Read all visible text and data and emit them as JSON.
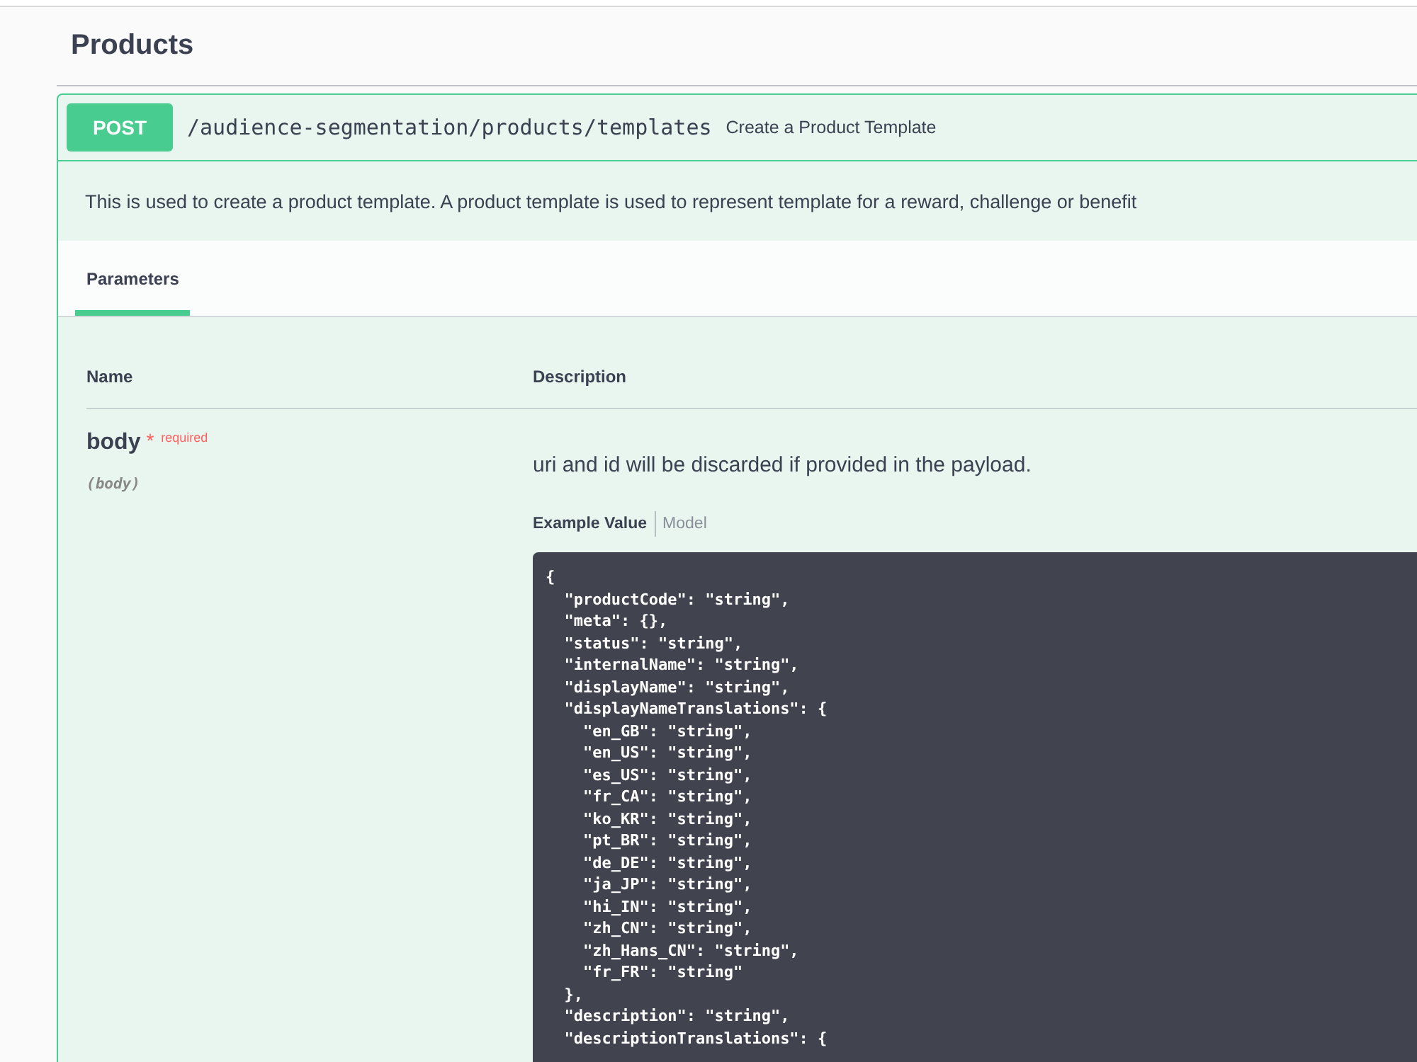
{
  "section": {
    "title": "Products"
  },
  "operation": {
    "method": "POST",
    "path": "/audience-segmentation/products/templates",
    "summary": "Create a Product Template",
    "description": "This is used to create a product template. A product template is used to represent template for a reward, challenge or benefit",
    "tabs": [
      {
        "label": "Parameters",
        "selected": true
      }
    ],
    "parameters": {
      "columns": [
        "Name",
        "Description"
      ],
      "rows": [
        {
          "name": "body",
          "required_mark": "*",
          "required_label": "required",
          "location": "(body)",
          "description": "uri and id will be discarded if provided in the payload.",
          "example_tabs": [
            {
              "label": "Example Value",
              "selected": true
            },
            {
              "label": "Model",
              "selected": false
            }
          ],
          "example_lines": [
            "{",
            "  \"productCode\": \"string\",",
            "  \"meta\": {},",
            "  \"status\": \"string\",",
            "  \"internalName\": \"string\",",
            "  \"displayName\": \"string\",",
            "  \"displayNameTranslations\": {",
            "    \"en_GB\": \"string\",",
            "    \"en_US\": \"string\",",
            "    \"es_US\": \"string\",",
            "    \"fr_CA\": \"string\",",
            "    \"ko_KR\": \"string\",",
            "    \"pt_BR\": \"string\",",
            "    \"de_DE\": \"string\",",
            "    \"ja_JP\": \"string\",",
            "    \"hi_IN\": \"string\",",
            "    \"zh_CN\": \"string\",",
            "    \"zh_Hans_CN\": \"string\",",
            "    \"fr_FR\": \"string\"",
            "  },",
            "  \"description\": \"string\",",
            "  \"descriptionTranslations\": {"
          ]
        }
      ]
    }
  }
}
